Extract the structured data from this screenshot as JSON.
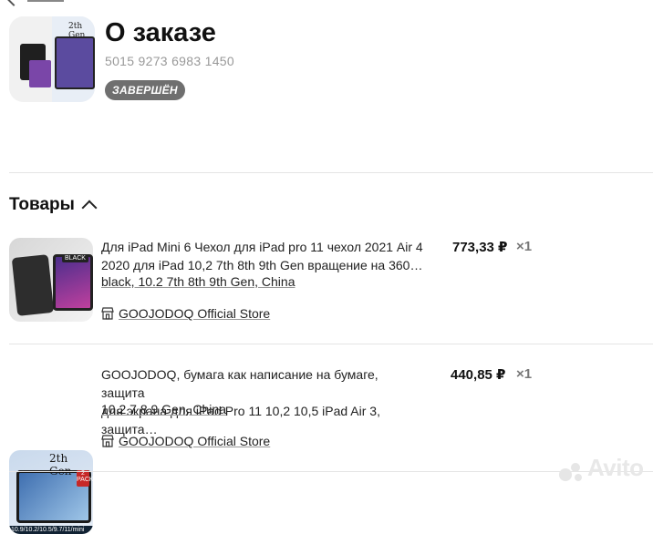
{
  "header": {
    "title": "О заказе",
    "order_number": "5015 9273 6983 1450",
    "status": "ЗАВЕРШЁН"
  },
  "products_section": {
    "title": "Товары",
    "items": [
      {
        "title_line1": "Для iPad Mini 6 Чехол для iPad pro 11 чехол 2021 Air 4",
        "title_line2": "2020 для iPad 10,2 7th 8th 9th Gen вращение на 360…",
        "variant": "black, 10.2 7th 8th 9th Gen, China",
        "store": "GOOJODOQ Official Store",
        "price": "773,33 ₽",
        "quantity": "×1",
        "image_label": "BLACK"
      },
      {
        "title_line1": "GOOJODOQ, бумага как написание на бумаге, защита",
        "title_line2": "для экрана для iPad Pro 11 10,2 10,5 iPad Air 3, защита…",
        "variant": "10.2 7 8 9 Gen, China",
        "store": "GOOJODOQ Official Store",
        "price": "440,85 ₽",
        "quantity": "×1",
        "image_label": "2th Gen",
        "image_footer": "10.9/10.2/10.5/9.7/11/mini",
        "image_badge": "2 PACK"
      }
    ]
  },
  "header_thumbs": {
    "right_caption": "2th Gen"
  },
  "watermark": "Avito",
  "colors": {
    "badge_bg": "#6f6f6f",
    "divider": "#e5e5e5",
    "muted_text": "#999999"
  }
}
